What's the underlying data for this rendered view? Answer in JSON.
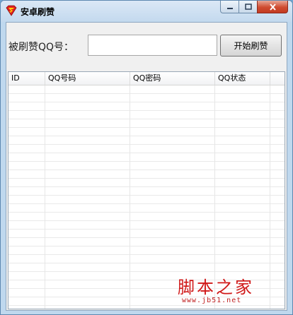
{
  "window": {
    "title": "安卓刷赞",
    "icon": "superman-shield-icon",
    "accent": "#d01818"
  },
  "form": {
    "qq_label": "被刷赞QQ号：",
    "qq_value": "",
    "start_button": "开始刷赞"
  },
  "table": {
    "columns": [
      "ID",
      "QQ号码",
      "QQ密码",
      "QQ状态"
    ],
    "rows": []
  },
  "watermark": {
    "text": "脚本之家",
    "url": "www.jb51.net"
  }
}
